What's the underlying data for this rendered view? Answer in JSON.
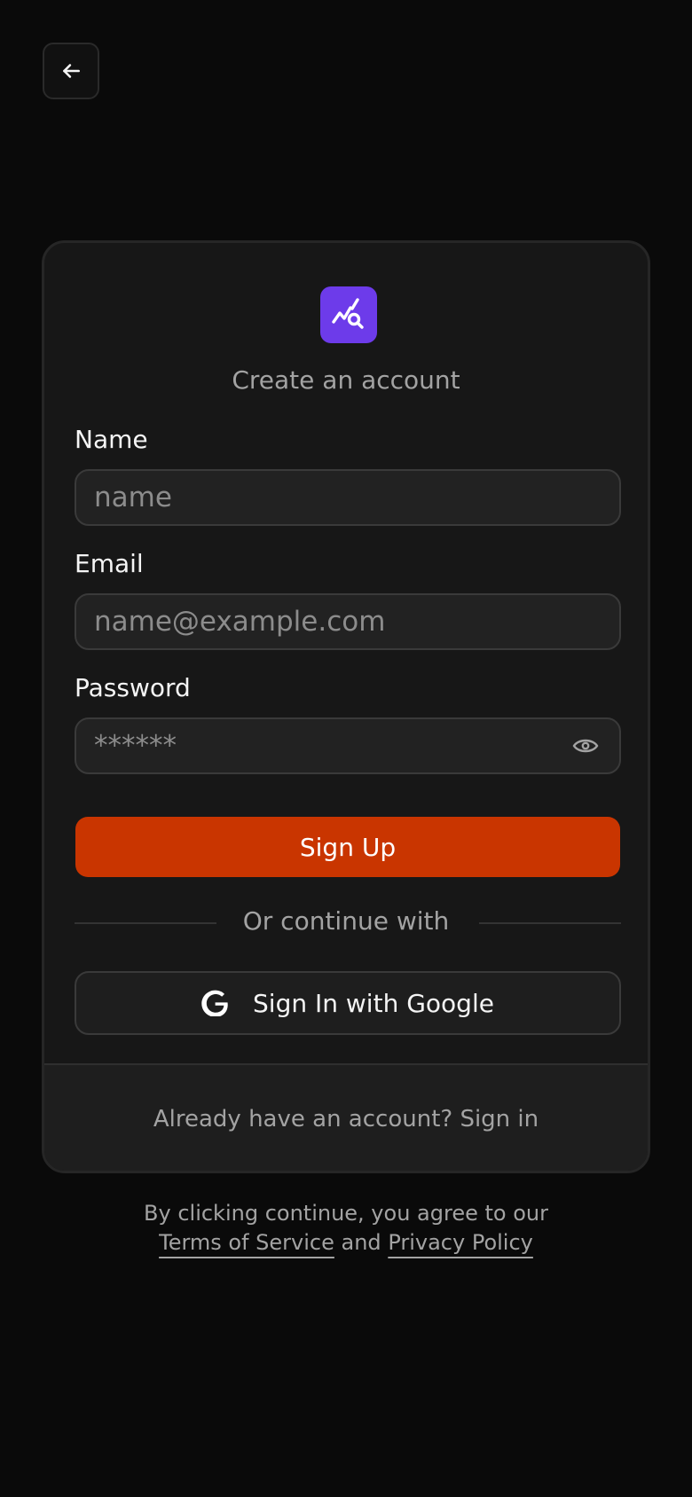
{
  "nav": {
    "back_icon": "arrow-left-icon"
  },
  "brand": {
    "logo_icon": "chart-search-icon",
    "logo_color": "#6d3bea"
  },
  "form": {
    "subtitle": "Create an account",
    "name": {
      "label": "Name",
      "placeholder": "name",
      "value": ""
    },
    "email": {
      "label": "Email",
      "placeholder": "name@example.com",
      "value": ""
    },
    "password": {
      "label": "Password",
      "placeholder": "******",
      "value": "",
      "toggle_icon": "eye-icon"
    },
    "submit_label": "Sign Up",
    "submit_color": "#c93500",
    "divider_text": "Or continue with",
    "google_label": "Sign In with Google",
    "google_icon": "google-icon"
  },
  "footer": {
    "signin_prompt": "Already have an account? Sign in"
  },
  "legal": {
    "prefix": "By clicking continue, you agree to our",
    "terms": "Terms of Service",
    "and": "and",
    "privacy": "Privacy Policy"
  }
}
